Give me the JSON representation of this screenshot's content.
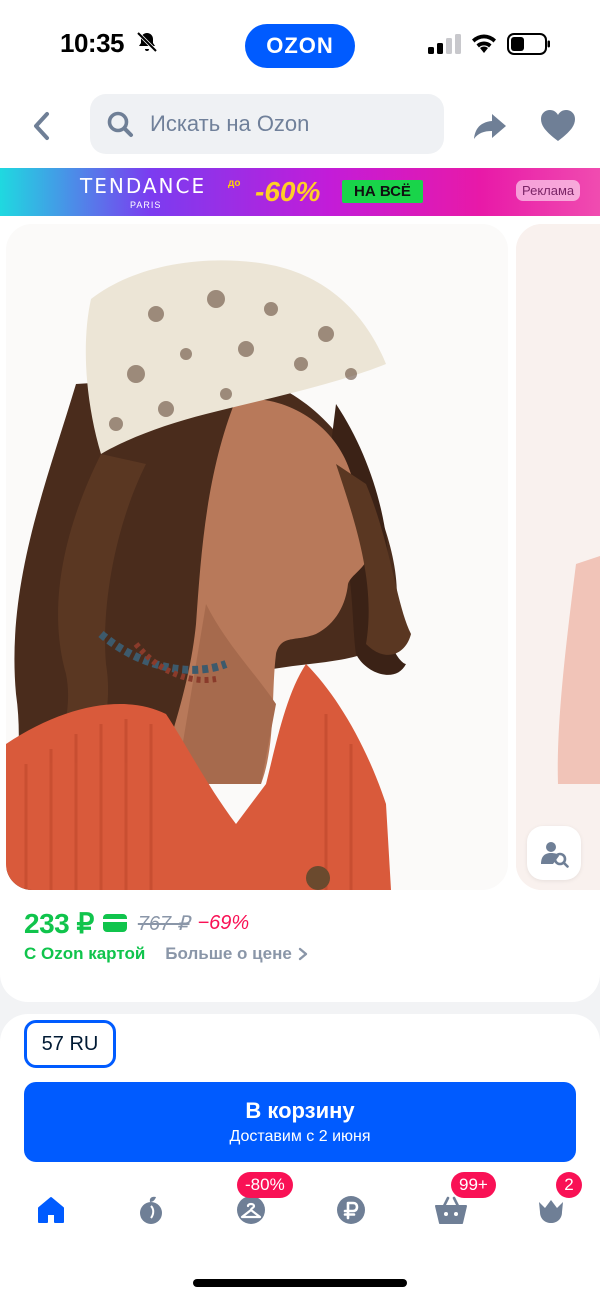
{
  "status_bar": {
    "time": "10:35",
    "app_badge": "OZON"
  },
  "header": {
    "search_placeholder": "Искать на Ozon"
  },
  "banner": {
    "brand": "TENDANCE",
    "brand_sub": "PARIS",
    "upto": "до",
    "discount": "-60%",
    "all": "НА ВСЁ",
    "ad_label": "Реклама"
  },
  "product": {
    "price": "233 ₽",
    "old_price": "767 ₽",
    "discount": "−69%",
    "with_card": "С Ozon картой",
    "more_about_price": "Больше о цене"
  },
  "buy": {
    "size": "57 RU",
    "cart_label": "В корзину",
    "delivery": "Доставим с 2 июня"
  },
  "tabbar": {
    "items": [
      {
        "icon": "home-icon",
        "badge": ""
      },
      {
        "icon": "fresh-icon",
        "badge": ""
      },
      {
        "icon": "sale-hanger-icon",
        "badge": "-80%"
      },
      {
        "icon": "ruble-icon",
        "badge": ""
      },
      {
        "icon": "cart-icon",
        "badge": "99+"
      },
      {
        "icon": "profile-icon",
        "badge": "2"
      }
    ]
  },
  "colors": {
    "accent": "#005bff",
    "price_green": "#10c44c",
    "discount_pink": "#f91155"
  }
}
